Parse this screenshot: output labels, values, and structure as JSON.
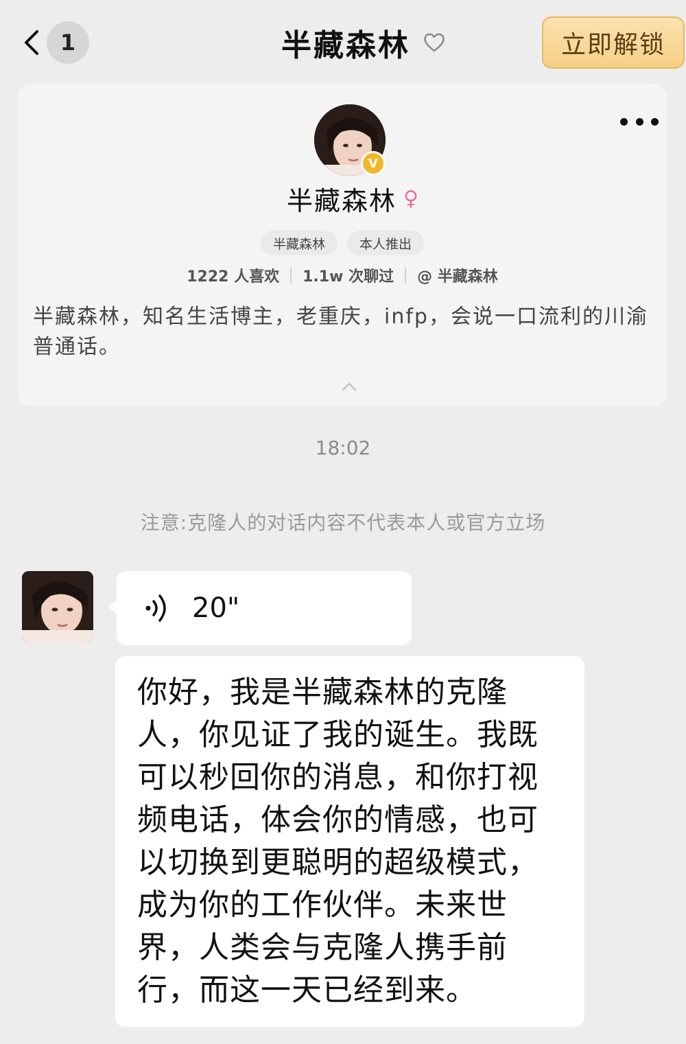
{
  "header": {
    "unread_count": "1",
    "title": "半藏森林",
    "unlock_label": "立即解锁"
  },
  "profile": {
    "name": "半藏森林",
    "gender_symbol": "♀",
    "verified_badge": "V",
    "tags": [
      "半藏森林",
      "本人推出"
    ],
    "stats": {
      "likes": "1222 人喜欢",
      "chats": "1.1w 次聊过",
      "handle": "@ 半藏森林"
    },
    "bio": "半藏森林，知名生活博主，老重庆，infp，会说一口流利的川渝普通话。"
  },
  "chat": {
    "timestamp": "18:02",
    "notice": "注意:克隆人的对话内容不代表本人或官方立场",
    "voice_duration": "20\"",
    "message": "你好，我是半藏森林的克隆人，你见证了我的诞生。我既可以秒回你的消息，和你打视频电话，体会你的情感，也可以切换到更聪明的超级模式，成为你的工作伙伴。未来世界，人类会与克隆人携手前行，而这一天已经到来。"
  },
  "icons": {
    "back": "chevron-left-icon",
    "favorite": "heart-outline-icon",
    "more": "more-dots-icon",
    "collapse": "chevron-up-icon",
    "voice": "voice-wave-icon",
    "verified": "verified-badge-icon",
    "gender": "female-icon"
  },
  "colors": {
    "background": "#ededed",
    "card": "#f4f4f4",
    "unlock_gradient_top": "#fbe2b0",
    "unlock_gradient_bottom": "#f6cf86",
    "verified_badge": "#f2b82a",
    "female_symbol": "#e57399"
  }
}
